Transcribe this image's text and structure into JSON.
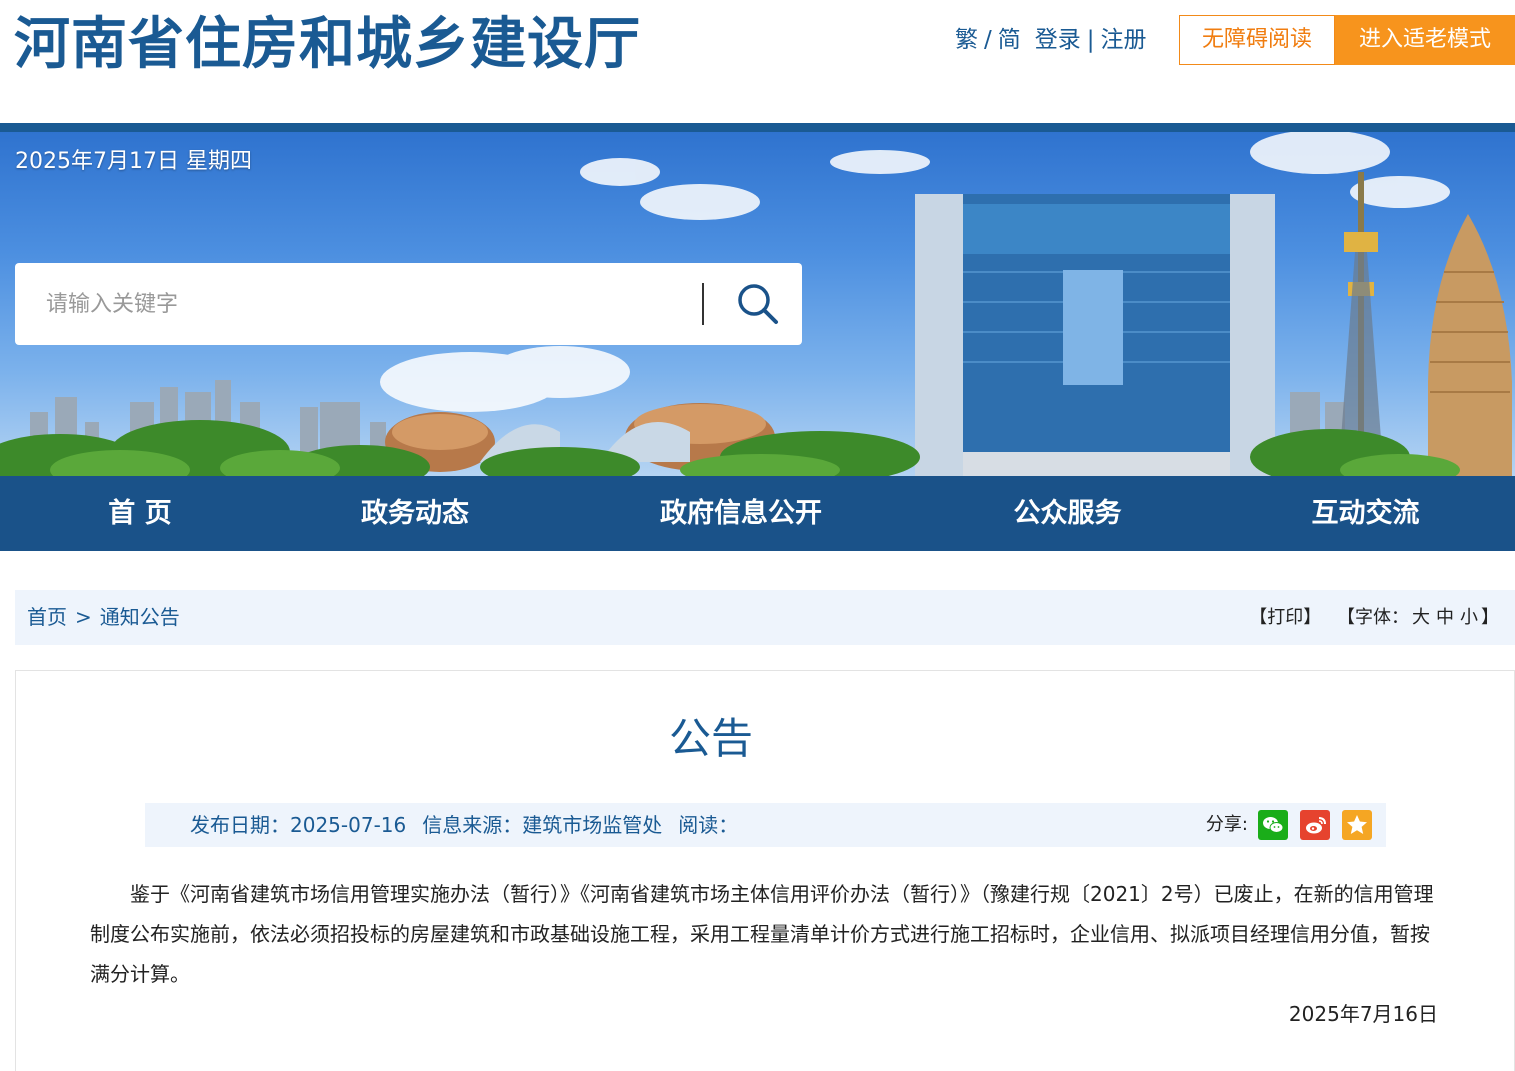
{
  "header": {
    "site_title": "河南省住房和城乡建设厅",
    "lang_trad": "繁",
    "lang_sep": "/",
    "lang_simp": "简",
    "login": "登录",
    "auth_sep": "|",
    "register": "注册",
    "accessible_label": "无障碍阅读",
    "elder_mode_label": "进入适老模式"
  },
  "banner": {
    "date": "2025年7月17日 星期四"
  },
  "search": {
    "placeholder": "请输入关键字",
    "icon": "search-icon"
  },
  "nav": {
    "items": [
      {
        "label": "首 页"
      },
      {
        "label": "政务动态"
      },
      {
        "label": "政府信息公开"
      },
      {
        "label": "公众服务"
      },
      {
        "label": "互动交流"
      }
    ]
  },
  "breadcrumb": {
    "home": "首页",
    "separator": ">",
    "current": "通知公告"
  },
  "tools": {
    "print": "【打印】",
    "font_prefix": "【字体：",
    "font_large": "大",
    "font_medium": "中",
    "font_small": "小",
    "font_suffix": "】"
  },
  "article": {
    "title": "公告",
    "publish_date": "发布日期：2025-07-16",
    "source": "信息来源：建筑市场监管处",
    "reads": "阅读：",
    "share_label": "分享:",
    "share_icons": [
      "wechat-icon",
      "weibo-icon",
      "favorite-icon"
    ],
    "body": "鉴于《河南省建筑市场信用管理实施办法（暂行）》《河南省建筑市场主体信用评价办法（暂行）》（豫建行规〔2021〕2号）已废止，在新的信用管理制度公布实施前，依法必须招投标的房屋建筑和市政基础设施工程，采用工程量清单计价方式进行施工招标时，企业信用、拟派项目经理信用分值，暂按满分计算。",
    "sign_date": "2025年7月16日"
  },
  "colors": {
    "brand_blue": "#1a5a93",
    "nav_blue": "#1a5289",
    "accent_orange": "#f7941d",
    "light_panel": "#eef4fc"
  }
}
